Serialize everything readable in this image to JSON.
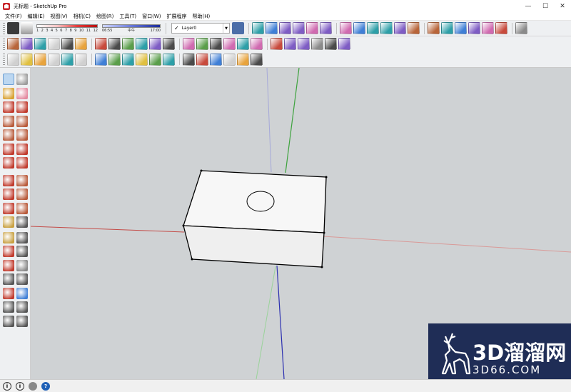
{
  "window": {
    "title": "无标题 - SketchUp Pro",
    "icon": "sketchup-icon",
    "controls": {
      "minimize": "—",
      "maximize": "☐",
      "close": "✕"
    }
  },
  "menu": [
    "文件(F)",
    "编辑(E)",
    "视图(V)",
    "相机(C)",
    "绘图(R)",
    "工具(T)",
    "窗口(W)",
    "扩展程序",
    "帮助(H)"
  ],
  "shadow": {
    "month_ticks": [
      "1",
      "2",
      "3",
      "4",
      "5",
      "6",
      "7",
      "8",
      "9",
      "10",
      "11",
      "12"
    ],
    "time_start": "06:55",
    "time_mid": "中午",
    "time_end": "17:00"
  },
  "layer": {
    "checked": "✓",
    "name": "Layer0",
    "dropdown": "▼"
  },
  "toolbar_icons": {
    "row1": [
      "shadow-toggle-icon",
      "fog-icon",
      "layer-manager-icon",
      "iso-view-icon",
      "top-view-icon",
      "front-view-icon",
      "right-view-icon",
      "back-view-icon",
      "left-view-icon",
      "xray-icon",
      "wireframe-icon",
      "hidden-line-icon",
      "shaded-icon",
      "textured-icon",
      "monochrome-icon",
      "plugin-m-icon",
      "plugin-r-icon",
      "plugin-rt-icon",
      "plugin-br-icon"
    ],
    "row2": [
      "select-icon",
      "eraser-icon",
      "box-icon",
      "push-pull-icon",
      "follow-me-icon",
      "offset-icon",
      "move-icon",
      "rotate-icon",
      "scale-icon",
      "tape-icon",
      "dimension-icon",
      "protractor-icon",
      "text-icon",
      "axes-icon",
      "3d-text-icon",
      "section-plane-icon",
      "orbit-icon",
      "pan-icon",
      "zoom-icon",
      "zoom-extents-icon",
      "polygon-icon",
      "circle-icon",
      "arc-icon",
      "line-icon"
    ],
    "row3": [
      "paint-bucket-icon",
      "warehouse-icon",
      "extension-icon",
      "component-icon",
      "group-icon",
      "solid-union-icon",
      "solid-subtract-icon",
      "solid-trim-icon",
      "intersect-icon",
      "split-icon",
      "sandbox-icon",
      "smoove-icon",
      "stamp-icon",
      "drape-icon",
      "add-detail-icon",
      "flip-edge-icon",
      "photo-match-icon",
      "skin-icon"
    ]
  },
  "left_tools": [
    "select-tool",
    "make-component-tool",
    "paint-bucket-tool",
    "eraser-tool",
    "line-tool",
    "freehand-tool",
    "rectangle-tool",
    "rotated-rectangle-tool",
    "circle-tool",
    "polygon-tool",
    "arc-tool",
    "pie-tool",
    "two-point-arc-tool",
    "three-point-arc-tool",
    "move-tool",
    "push-pull-tool",
    "rotate-tool",
    "follow-me-tool",
    "scale-tool",
    "offset-tool",
    "tape-measure-tool",
    "text-tool",
    "protractor-tool",
    "3d-text-tool",
    "axes-tool",
    "dimension-tool",
    "orbit-tool",
    "pan-tool",
    "zoom-tool",
    "zoom-window-tool",
    "zoom-extents-tool",
    "previous-view-tool",
    "position-camera-tool",
    "look-around-tool",
    "walk-tool",
    "section-plane-tool"
  ],
  "viewport": {
    "background": "#cfd2d4",
    "axis_colors": {
      "red": "#c44b47",
      "green": "#3ea33e",
      "blue": "#2b2fb0"
    },
    "model": "box-with-circle"
  },
  "watermark": {
    "brand": "3D溜溜网",
    "url": "3D66.COM",
    "logo": "deer-logo-icon",
    "background": "#1f2d56"
  },
  "status": {
    "icons": [
      "geo-location-icon",
      "credits-icon",
      "user-icon",
      "help-icon"
    ],
    "help_glyph": "?",
    "info_glyph": "i"
  }
}
